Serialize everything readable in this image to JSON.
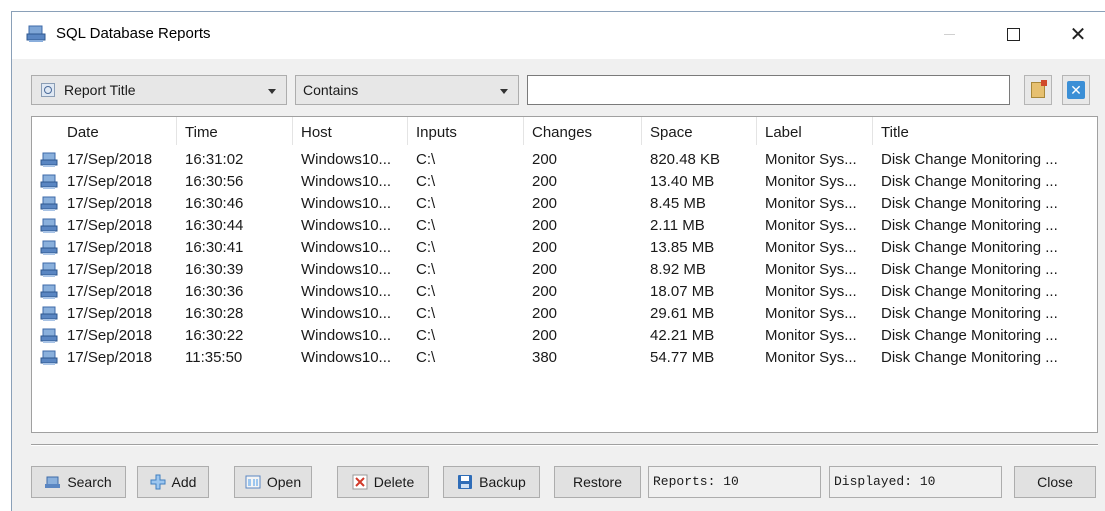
{
  "window": {
    "title": "SQL Database Reports"
  },
  "filter": {
    "field": "Report Title",
    "operator": "Contains",
    "query": "",
    "placeholder": ""
  },
  "table": {
    "columns": [
      "Date",
      "Time",
      "Host",
      "Inputs",
      "Changes",
      "Space",
      "Label",
      "Title"
    ],
    "rows": [
      {
        "date": "17/Sep/2018",
        "time": "16:31:02",
        "host": "Windows10...",
        "inputs": "C:\\",
        "changes": "200",
        "space": "820.48 KB",
        "label": "Monitor Sys...",
        "title": "Disk Change Monitoring ..."
      },
      {
        "date": "17/Sep/2018",
        "time": "16:30:56",
        "host": "Windows10...",
        "inputs": "C:\\",
        "changes": "200",
        "space": "13.40 MB",
        "label": "Monitor Sys...",
        "title": "Disk Change Monitoring ..."
      },
      {
        "date": "17/Sep/2018",
        "time": "16:30:46",
        "host": "Windows10...",
        "inputs": "C:\\",
        "changes": "200",
        "space": "8.45 MB",
        "label": "Monitor Sys...",
        "title": "Disk Change Monitoring ..."
      },
      {
        "date": "17/Sep/2018",
        "time": "16:30:44",
        "host": "Windows10...",
        "inputs": "C:\\",
        "changes": "200",
        "space": "2.11 MB",
        "label": "Monitor Sys...",
        "title": "Disk Change Monitoring ..."
      },
      {
        "date": "17/Sep/2018",
        "time": "16:30:41",
        "host": "Windows10...",
        "inputs": "C:\\",
        "changes": "200",
        "space": "13.85 MB",
        "label": "Monitor Sys...",
        "title": "Disk Change Monitoring ..."
      },
      {
        "date": "17/Sep/2018",
        "time": "16:30:39",
        "host": "Windows10...",
        "inputs": "C:\\",
        "changes": "200",
        "space": "8.92 MB",
        "label": "Monitor Sys...",
        "title": "Disk Change Monitoring ..."
      },
      {
        "date": "17/Sep/2018",
        "time": "16:30:36",
        "host": "Windows10...",
        "inputs": "C:\\",
        "changes": "200",
        "space": "18.07 MB",
        "label": "Monitor Sys...",
        "title": "Disk Change Monitoring ..."
      },
      {
        "date": "17/Sep/2018",
        "time": "16:30:28",
        "host": "Windows10...",
        "inputs": "C:\\",
        "changes": "200",
        "space": "29.61 MB",
        "label": "Monitor Sys...",
        "title": "Disk Change Monitoring ..."
      },
      {
        "date": "17/Sep/2018",
        "time": "16:30:22",
        "host": "Windows10...",
        "inputs": "C:\\",
        "changes": "200",
        "space": "42.21 MB",
        "label": "Monitor Sys...",
        "title": "Disk Change Monitoring ..."
      },
      {
        "date": "17/Sep/2018",
        "time": "11:35:50",
        "host": "Windows10...",
        "inputs": "C:\\",
        "changes": "380",
        "space": "54.77 MB",
        "label": "Monitor Sys...",
        "title": "Disk Change Monitoring ..."
      }
    ]
  },
  "buttons": {
    "search": "Search",
    "add": "Add",
    "open": "Open",
    "delete": "Delete",
    "backup": "Backup",
    "restore": "Restore",
    "close": "Close"
  },
  "status": {
    "reports": "Reports: 10",
    "displayed": "Displayed: 10"
  },
  "colors": {
    "accent": "#3b8fd6",
    "row_icon": "#4a78b0"
  }
}
